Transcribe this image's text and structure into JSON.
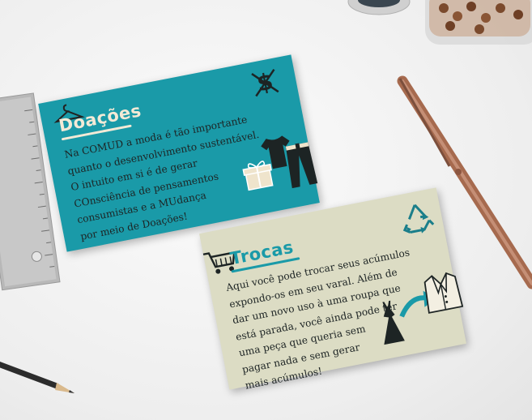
{
  "cards": {
    "donations": {
      "title": "Doações",
      "lines": [
        "Na COMUD a moda é tão importante",
        "quanto o desenvolvimento sustentável.",
        "O intuito em si é de gerar",
        "COnsciência de pensamentos",
        "consumistas e a MUdança",
        "por meio de Doações!"
      ],
      "icons": [
        "hanger-icon",
        "no-money-icon",
        "tshirt-icon",
        "pants-icon",
        "gift-icon"
      ]
    },
    "trades": {
      "title": "Trocas",
      "lines": [
        "Aqui você pode trocar seus acúmulos",
        "expondo-os em seu varal. Além de",
        "dar um novo uso à uma roupa que",
        "está parada, você ainda pode ter",
        "uma peça que queria sem",
        "pagar nada e sem gerar",
        "mais acúmulos!"
      ],
      "icons": [
        "shopping-cart-icon",
        "recycle-icon",
        "dress-icon",
        "arrow-icon",
        "blazer-icon"
      ]
    }
  },
  "colors": {
    "teal": "#1a9aa8",
    "cream": "#dcdcc4",
    "desk": "#f0f0f0",
    "pen": "#b07a5e"
  }
}
